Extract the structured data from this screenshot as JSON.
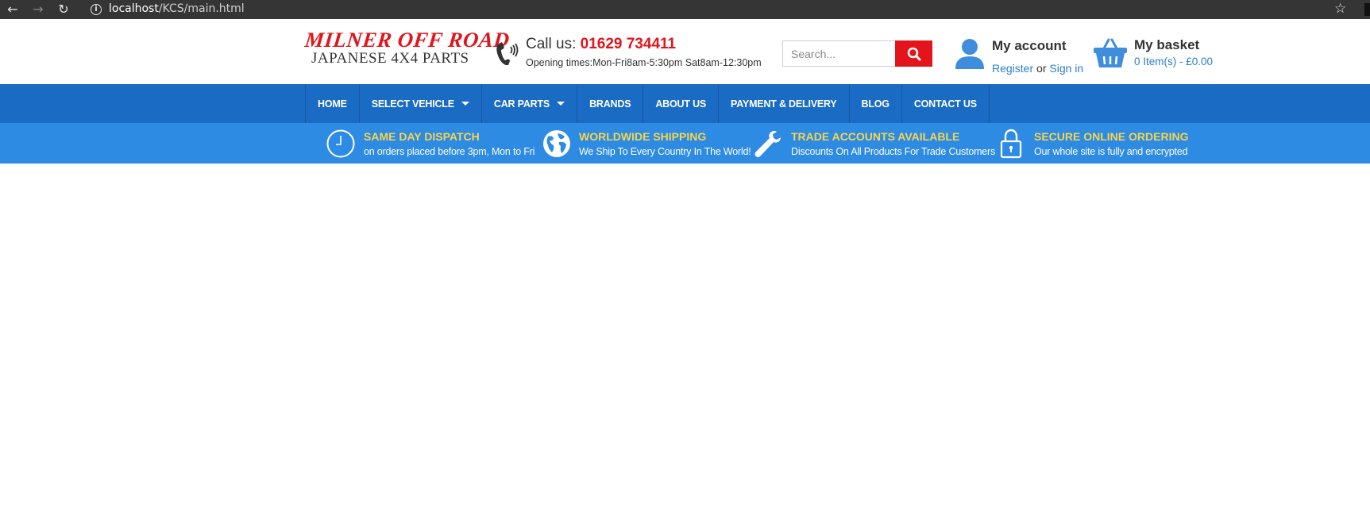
{
  "browser": {
    "url_host": "localhost",
    "url_path": "/KCS/main.html",
    "icons": [
      "back-arrow-icon",
      "forward-arrow-icon",
      "reload-icon",
      "info-icon",
      "star-icon"
    ]
  },
  "header": {
    "logo_line1": "MILNER OFF ROAD",
    "logo_line2": "JAPANESE 4X4 PARTS",
    "call_label": "Call us: ",
    "call_number": "01629 734411",
    "opening_times": "Opening times:Mon-Fri8am-5:30pm Sat8am-12:30pm",
    "search_placeholder": "Search...",
    "account_title": "My account",
    "register_label": "Register",
    "or_label": " or ",
    "signin_label": "Sign in",
    "basket_title": "My basket",
    "basket_summary": "0 Item(s) - £0.00"
  },
  "nav": {
    "items": [
      {
        "label": "HOME",
        "dropdown": false
      },
      {
        "label": "SELECT VEHICLE",
        "dropdown": true
      },
      {
        "label": "CAR PARTS",
        "dropdown": true
      },
      {
        "label": "BRANDS",
        "dropdown": false
      },
      {
        "label": "ABOUT US",
        "dropdown": false
      },
      {
        "label": "PAYMENT & DELIVERY",
        "dropdown": false
      },
      {
        "label": "BLOG",
        "dropdown": false
      },
      {
        "label": "CONTACT US",
        "dropdown": false
      }
    ]
  },
  "features": [
    {
      "icon": "clock-icon",
      "title": "SAME DAY DISPATCH",
      "subtitle": "on orders placed before 3pm, Mon to Fri"
    },
    {
      "icon": "globe-icon",
      "title": "WORLDWIDE SHIPPING",
      "subtitle": "We Ship To Every Country In The World!"
    },
    {
      "icon": "wrench-icon",
      "title": "TRADE ACCOUNTS AVAILABLE",
      "subtitle": "Discounts On All Products For Trade Customers"
    },
    {
      "icon": "padlock-icon",
      "title": "SECURE ONLINE ORDERING",
      "subtitle": "Our whole site is fully and encrypted"
    }
  ],
  "colors": {
    "brand_red": "#e3141b",
    "nav_blue": "#1a6bc4",
    "feature_blue": "#2d8be4",
    "feature_title_yellow": "#f7d54a",
    "link_blue": "#2a7dd1"
  }
}
